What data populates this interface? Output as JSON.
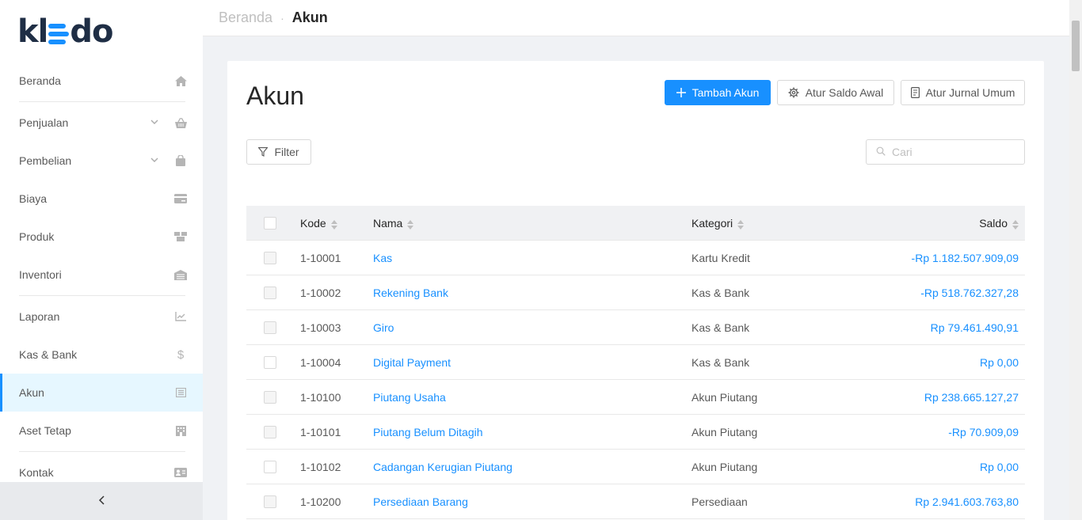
{
  "brand": {
    "logo_left": "kl",
    "logo_right": "do"
  },
  "sidebar": {
    "items": [
      {
        "label": "Beranda",
        "icon": "home-icon"
      },
      {
        "label": "Penjualan",
        "icon": "basket-icon",
        "expandable": true
      },
      {
        "label": "Pembelian",
        "icon": "bag-icon",
        "expandable": true
      },
      {
        "label": "Biaya",
        "icon": "card-icon"
      },
      {
        "label": "Produk",
        "icon": "boxes-icon"
      },
      {
        "label": "Inventori",
        "icon": "warehouse-icon"
      },
      {
        "label": "Laporan",
        "icon": "chart-icon"
      },
      {
        "label": "Kas & Bank",
        "icon": "dollar-icon"
      },
      {
        "label": "Akun",
        "icon": "list-icon",
        "active": true
      },
      {
        "label": "Aset Tetap",
        "icon": "building-icon"
      },
      {
        "label": "Kontak",
        "icon": "contact-card-icon"
      }
    ],
    "collapse_symbol": "<"
  },
  "breadcrumb": {
    "home": "Beranda",
    "separator": "·",
    "current": "Akun"
  },
  "page": {
    "title": "Akun",
    "add_button": "Tambah Akun",
    "saldo_awal_button": "Atur Saldo Awal",
    "jurnal_button": "Atur Jurnal Umum",
    "filter_button": "Filter",
    "search_placeholder": "Cari"
  },
  "table": {
    "columns": {
      "kode": "Kode",
      "nama": "Nama",
      "kategori": "Kategori",
      "saldo": "Saldo"
    },
    "rows": [
      {
        "kode": "1-10001",
        "nama": "Kas",
        "kategori": "Kartu Kredit",
        "saldo": "-Rp 1.182.507.909,09"
      },
      {
        "kode": "1-10002",
        "nama": "Rekening Bank",
        "kategori": "Kas & Bank",
        "saldo": "-Rp 518.762.327,28"
      },
      {
        "kode": "1-10003",
        "nama": "Giro",
        "kategori": "Kas & Bank",
        "saldo": "Rp 79.461.490,91"
      },
      {
        "kode": "1-10004",
        "nama": "Digital Payment",
        "kategori": "Kas & Bank",
        "saldo": "Rp 0,00"
      },
      {
        "kode": "1-10100",
        "nama": "Piutang Usaha",
        "kategori": "Akun Piutang",
        "saldo": "Rp 238.665.127,27"
      },
      {
        "kode": "1-10101",
        "nama": "Piutang Belum Ditagih",
        "kategori": "Akun Piutang",
        "saldo": "-Rp 70.909,09"
      },
      {
        "kode": "1-10102",
        "nama": "Cadangan Kerugian Piutang",
        "kategori": "Akun Piutang",
        "saldo": "Rp 0,00"
      },
      {
        "kode": "1-10200",
        "nama": "Persediaan Barang",
        "kategori": "Persediaan",
        "saldo": "Rp 2.941.603.763,80"
      }
    ]
  },
  "colors": {
    "accent": "#1890ff",
    "sidebar_active_bg": "#e6f7ff",
    "brand_dark": "#1f2e45"
  }
}
